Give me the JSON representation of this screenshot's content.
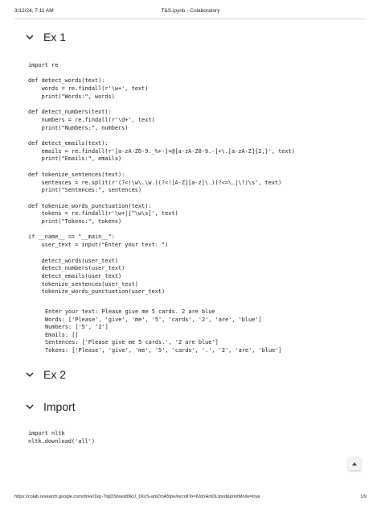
{
  "print_header": {
    "date": "3/12/24, 7:11 AM",
    "title": "T&S.ipynb - Colaboratory"
  },
  "sections": {
    "ex1": "Ex 1",
    "ex2": "Ex 2",
    "import": "Import"
  },
  "icons": {
    "section_toggle": "chevron-down-icon",
    "scroll_top": "chevron-up-icon"
  },
  "code_cell_1": [
    "import re",
    "",
    "def detect_words(text):",
    "    words = re.findall(r'\\w+', text)",
    "    print(\"Words:\", words)",
    "",
    "def detect_numbers(text):",
    "    numbers = re.findall(r'\\d+', text)",
    "    print(\"Numbers:\", numbers)",
    "",
    "def detect_emails(text):",
    "    emails = re.findall(r'[a-zA-Z0-9._%+-]+@[a-zA-Z0-9.-]+\\.[a-zA-Z]{2,}', text)",
    "    print(\"Emails:\", emails)",
    "",
    "def tokenize_sentences(text):",
    "    sentences = re.split(r'(?<!\\w\\.\\w.)(?<![A-Z][a-z]\\.)(?<=\\.|\\?)\\s', text)",
    "    print(\"Sentences:\", sentences)",
    "",
    "def tokenize_words_punctuation(text):",
    "    tokens = re.findall(r'\\w+|[^\\w\\s]', text)",
    "    print(\"Tokens:\", tokens)",
    "",
    "if __name__ == \"__main__\":",
    "    user_text = input(\"Enter your text: \")",
    "",
    "    detect_words(user_text)",
    "    detect_numbers(user_text)",
    "    detect_emails(user_text)",
    "    tokenize_sentences(user_text)",
    "    tokenize_words_punctuation(user_text)"
  ],
  "output_cell_1": [
    "Enter your text: Please give me 5 cards. 2 are blue",
    "Words: ['Please', 'give', 'me', '5', 'cards', '2', 'are', 'blue']",
    "Numbers: ['5', '2']",
    "Emails: []",
    "Sentences: ['Please give me 5 cards.', '2 are blue']",
    "Tokens: ['Please', 'give', 'me', '5', 'cards', '.', '2', 'are', 'blue']"
  ],
  "code_cell_2": [
    "import nltk",
    "nltk.download('all')"
  ],
  "print_footer": {
    "url": "https://colab.research.google.com/drive/1kp-7IipDStvwx89kU_1KoS-amZmA5tpe#scrollTo=IUdoHmDLtpnd&printMode=true",
    "page": "1/9"
  }
}
